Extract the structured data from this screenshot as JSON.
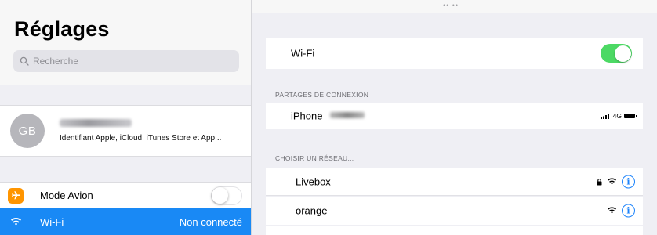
{
  "sidebar": {
    "title": "Réglages",
    "search_placeholder": "Recherche",
    "profile": {
      "initials": "GB",
      "subtitle": "Identifiant Apple, iCloud, iTunes Store et App..."
    },
    "items": [
      {
        "label": "Mode Avion",
        "icon": "airplane-icon",
        "icon_color": "#ff9500",
        "toggle": "off"
      },
      {
        "label": "Wi-Fi",
        "icon": "wifi-icon",
        "icon_color": "#1989f5",
        "value": "Non connecté",
        "selected": true
      }
    ]
  },
  "main": {
    "top_indicator": "•• ••",
    "wifi": {
      "label": "Wi-Fi",
      "toggle": "on",
      "toggle_color": "#4cd964"
    },
    "hotspot_header": "PARTAGES DE CONNEXION",
    "hotspot": {
      "name": "iPhone",
      "network": "4G"
    },
    "networks_header": "CHOISIR UN RÉSEAU...",
    "networks": [
      {
        "name": "Livebox",
        "locked": true
      },
      {
        "name": "orange",
        "locked": false
      }
    ]
  },
  "colors": {
    "accent": "#1a82fb",
    "selected_row": "#1989f5"
  }
}
